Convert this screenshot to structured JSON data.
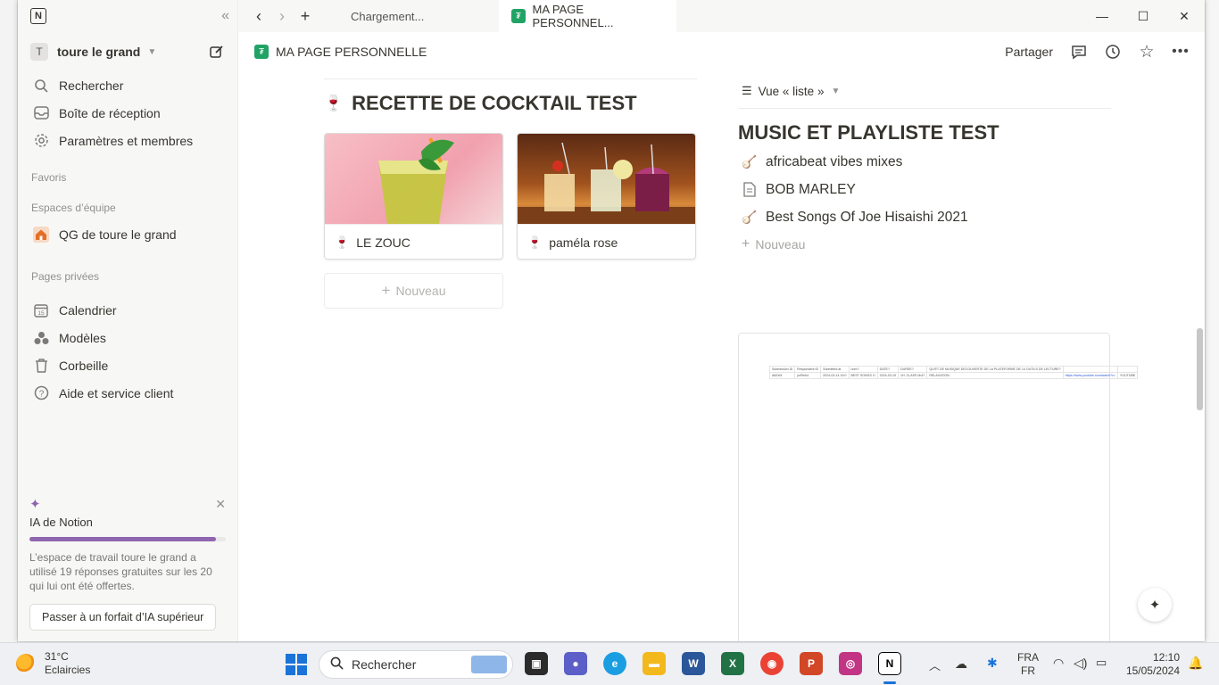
{
  "window": {
    "tabs": [
      {
        "label": "Chargement..."
      },
      {
        "label": "MA PAGE PERSONNEL..."
      }
    ]
  },
  "sidebar": {
    "workspace_initial": "T",
    "workspace_name": "toure le grand",
    "items": [
      {
        "label": "Rechercher",
        "icon": "search-icon"
      },
      {
        "label": "Boîte de réception",
        "icon": "inbox-icon"
      },
      {
        "label": "Paramètres et membres",
        "icon": "gear-icon"
      }
    ],
    "favorites_label": "Favoris",
    "team_label": "Espaces d’équipe",
    "team_item": "QG de toure le grand",
    "private_label": "Pages privées",
    "private_items": [
      {
        "label": "Calendrier",
        "icon": "calendar-icon"
      },
      {
        "label": "Modèles",
        "icon": "templates-icon"
      },
      {
        "label": "Corbeille",
        "icon": "trash-icon"
      },
      {
        "label": "Aide et service client",
        "icon": "help-icon"
      }
    ],
    "ai": {
      "title": "IA de Notion",
      "progress": 0.95,
      "text": "L’espace de travail toure le grand a utilisé 19 réponses gratuites sur les 20 qui lui ont été offertes.",
      "button": "Passer à un forfait d’IA supérieur"
    }
  },
  "header": {
    "breadcrumb": "MA PAGE PERSONNELLE",
    "share": "Partager"
  },
  "left": {
    "heading": "RECETTE DE COCKTAIL TEST",
    "cards": [
      {
        "label": "LE ZOUC"
      },
      {
        "label": "paméla rose"
      }
    ],
    "new_label": "Nouveau"
  },
  "right": {
    "view_label": "Vue « liste »",
    "heading": "MUSIC ET PLAYLISTE TEST",
    "items": [
      {
        "label": "africabeat vibes mixes",
        "icon": "guitar-icon"
      },
      {
        "label": "BOB MARLEY",
        "icon": "page-icon"
      },
      {
        "label": "Best Songs Of Joe Hisaishi 2021",
        "icon": "guitar-icon"
      }
    ],
    "new_label": "Nouveau"
  },
  "embed": {
    "header_row": [
      "Submission ID",
      "Respondent ID",
      "Submitted at",
      "nom?",
      "DATE?",
      "DUREE?",
      "QU'ET DE MUSIQUE DECOUVERTE DE LA PLATEFORME DE 14 OUTILS DE LECTURE?",
      "",
      ""
    ],
    "data_row": [
      "A8Zx0l",
      "ysPbrk4",
      "2024-03-14 15:0",
      "BEST SONGS O",
      "2024-03-15",
      "1H. CLASS 0h47",
      "RELAXATION",
      "https://www.youtube.com/watch?v=",
      "YOUTUBE"
    ]
  },
  "taskbar": {
    "temperature": "31°C",
    "weather": "Eclaircies",
    "search_placeholder": "Rechercher",
    "lang_top": "FRA",
    "lang_bottom": "FR",
    "time": "12:10",
    "date": "15/05/2024"
  },
  "colors": {
    "accent_ai": "#9065b0",
    "page_icon": "#21a366"
  }
}
